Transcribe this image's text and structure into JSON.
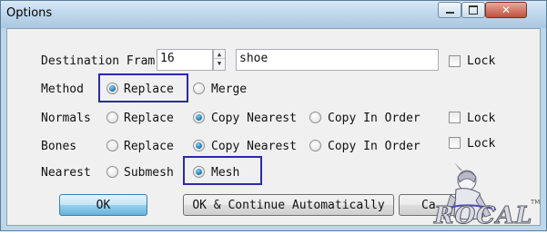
{
  "window": {
    "title": "Options",
    "controls": {
      "minimize": "minimize-icon",
      "maximize": "maximize-icon",
      "close": "close-icon"
    }
  },
  "destination": {
    "label": "Destination Fram",
    "spin_value": "16",
    "name_value": "shoe",
    "lock_label": "Lock",
    "lock_checked": false
  },
  "method": {
    "label": "Method",
    "options": [
      "Replace",
      "Merge"
    ],
    "selected": "Replace"
  },
  "normals": {
    "label": "Normals",
    "options": [
      "Replace",
      "Copy Nearest",
      "Copy In Order"
    ],
    "selected": "Copy Nearest",
    "lock_label": "Lock",
    "lock_checked": false
  },
  "bones": {
    "label": "Bones",
    "options": [
      "Replace",
      "Copy Nearest",
      "Copy In Order"
    ],
    "selected": "Copy Nearest",
    "lock_label": "Lock",
    "lock_checked": false
  },
  "nearest": {
    "label": "Nearest",
    "options": [
      "Submesh",
      "Mesh"
    ],
    "selected": "Mesh"
  },
  "buttons": {
    "ok": "OK",
    "continue": "OK & Continue Automatically",
    "cancel": "Ca"
  },
  "watermark": {
    "text": "ROCAL",
    "tm": "TM"
  },
  "colors": {
    "highlight": "#2a2aa8",
    "title_bar": "#bcd6ea",
    "default_button": "#98d1ef"
  }
}
